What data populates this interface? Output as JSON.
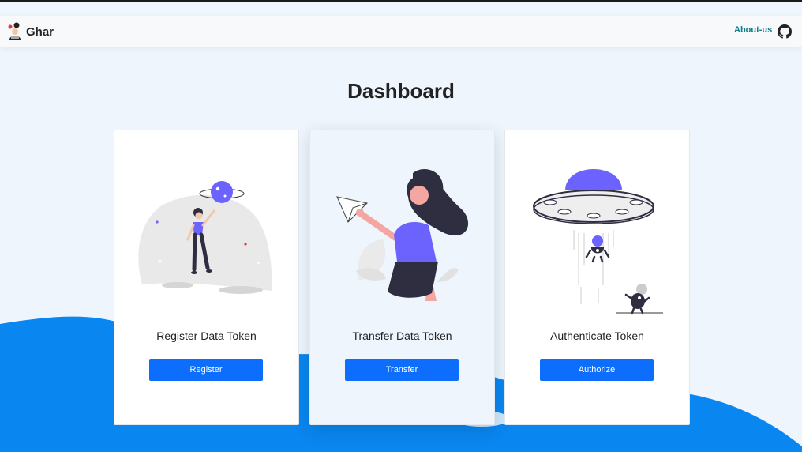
{
  "navbar": {
    "brand": "Ghar",
    "about_label": "About-us",
    "github_icon": "github-icon",
    "logo_icon": "ghar-logo-icon"
  },
  "page": {
    "title": "Dashboard"
  },
  "cards": [
    {
      "title": "Register Data Token",
      "button": "Register",
      "illustration": "astronaut-planet"
    },
    {
      "title": "Transfer Data Token",
      "button": "Transfer",
      "illustration": "woman-paper-plane"
    },
    {
      "title": "Authenticate Token",
      "button": "Authorize",
      "illustration": "ufo-abduction"
    }
  ],
  "colors": {
    "accent": "#0d6efd",
    "wave": "#0a86f0",
    "about_link": "#0e7c86",
    "illustration_purple": "#6c63ff",
    "background": "#eef5fd"
  }
}
